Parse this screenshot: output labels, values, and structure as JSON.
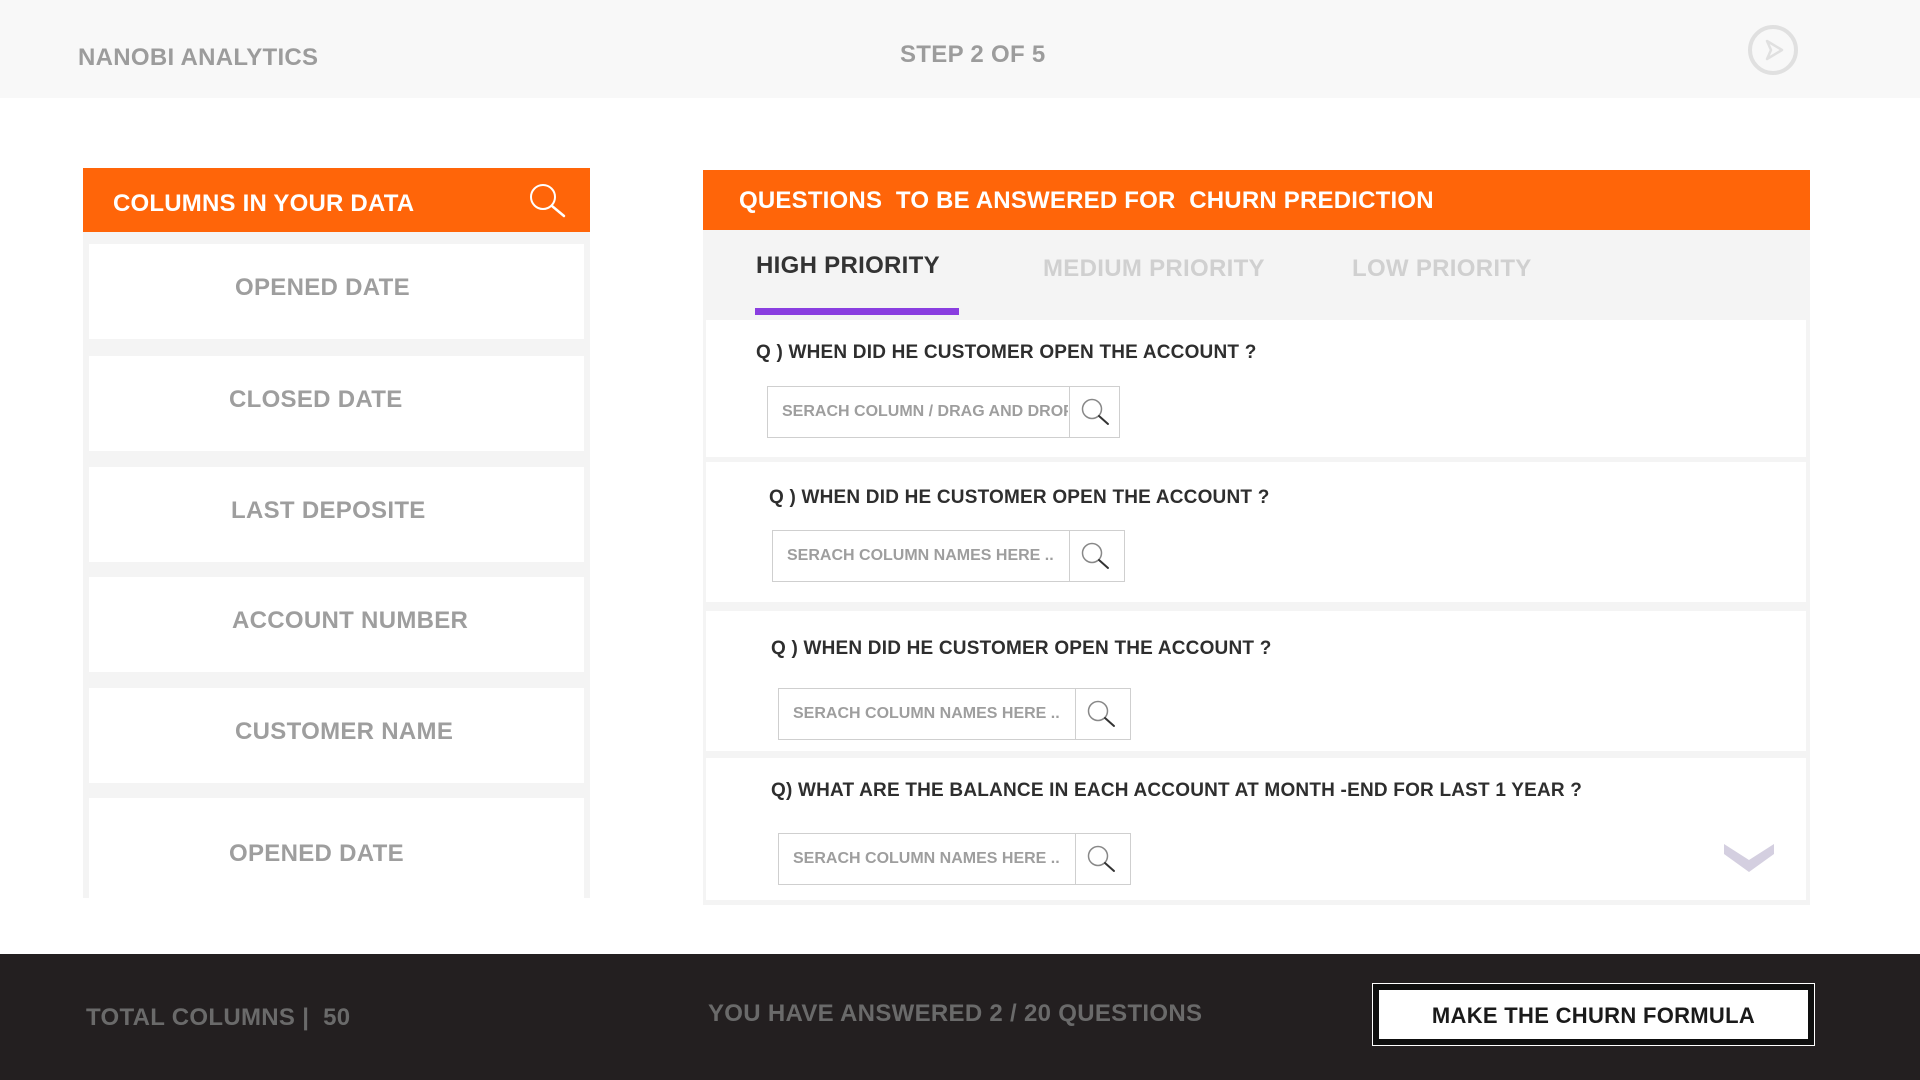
{
  "header": {
    "brand": "NANOBI ANALYTICS",
    "step": "STEP 2 OF 5",
    "next_icon": "play-arrow-circle-icon"
  },
  "columns_panel": {
    "title": "COLUMNS IN YOUR DATA",
    "search_icon": "search-icon",
    "items": [
      "OPENED DATE",
      "CLOSED DATE",
      "LAST DEPOSITE",
      "ACCOUNT NUMBER",
      "CUSTOMER NAME",
      "OPENED DATE"
    ]
  },
  "questions_panel": {
    "title": "QUESTIONS  TO BE ANSWERED FOR  CHURN PREDICTION",
    "tabs": [
      {
        "label": "HIGH PRIORITY",
        "active": true
      },
      {
        "label": "MEDIUM PRIORITY",
        "active": false
      },
      {
        "label": "LOW PRIORITY",
        "active": false
      }
    ],
    "questions": [
      {
        "text": "Q ) WHEN DID HE CUSTOMER OPEN THE ACCOUNT ?",
        "placeholder": "SERACH COLUMN / DRAG AND DROP"
      },
      {
        "text": "Q ) WHEN DID HE CUSTOMER OPEN THE ACCOUNT ?",
        "placeholder": "SERACH COLUMN NAMES HERE .."
      },
      {
        "text": "Q ) WHEN DID HE CUSTOMER OPEN THE ACCOUNT ?",
        "placeholder": "SERACH COLUMN NAMES HERE .."
      },
      {
        "text": "Q) WHAT ARE THE BALANCE IN EACH ACCOUNT AT MONTH -END FOR LAST 1 YEAR ?",
        "placeholder": "SERACH COLUMN NAMES HERE .."
      }
    ],
    "scroll_icon": "chevron-down-icon"
  },
  "footer": {
    "total_columns": "TOTAL COLUMNS |  50",
    "answered": "YOU HAVE ANSWERED 2 / 20 QUESTIONS",
    "cta": "MAKE THE CHURN FORMULA"
  },
  "colors": {
    "accent_orange": "#ff6509",
    "tab_underline": "#8a3ee0",
    "footer_bg": "#231f20"
  }
}
